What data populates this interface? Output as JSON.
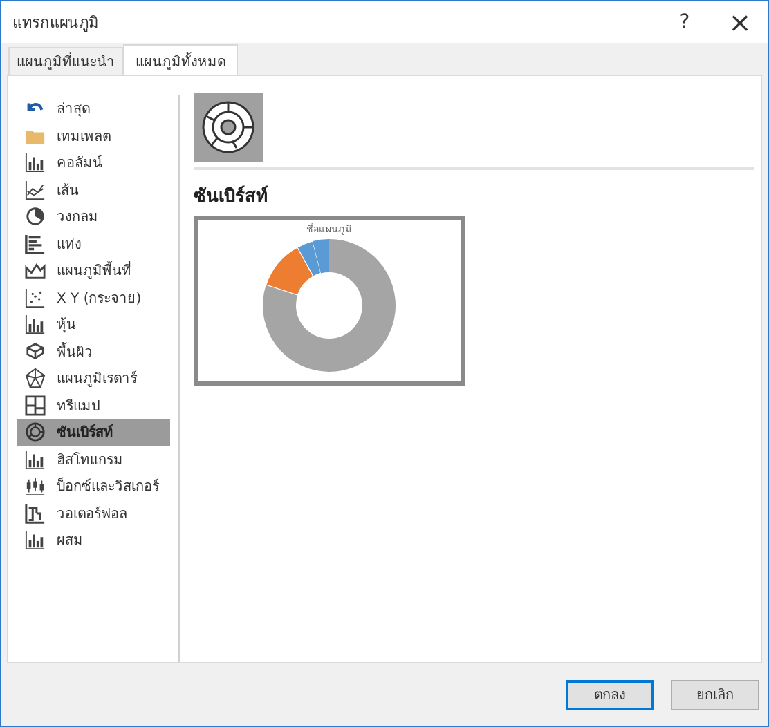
{
  "window": {
    "title": "แทรกแผนภูมิ",
    "help": "?",
    "close": "×"
  },
  "tabs": [
    {
      "label": "แผนภูมิที่แนะนำ",
      "selected": false
    },
    {
      "label": "แผนภูมิทั้งหมด",
      "selected": true
    }
  ],
  "sidebar": {
    "items": [
      {
        "label": "ล่าสุด",
        "selected": false
      },
      {
        "label": "เทมเพลต",
        "selected": false
      },
      {
        "label": "คอลัมน์",
        "selected": false
      },
      {
        "label": "เส้น",
        "selected": false
      },
      {
        "label": "วงกลม",
        "selected": false
      },
      {
        "label": "แท่ง",
        "selected": false
      },
      {
        "label": "แผนภูมิพื้นที่",
        "selected": false
      },
      {
        "label": "X Y (กระจาย)",
        "selected": false
      },
      {
        "label": "หุ้น",
        "selected": false
      },
      {
        "label": "พื้นผิว",
        "selected": false
      },
      {
        "label": "แผนภูมิเรดาร์",
        "selected": false
      },
      {
        "label": "ทรีแมป",
        "selected": false
      },
      {
        "label": "ซันเบิร์สท์",
        "selected": true
      },
      {
        "label": "ฮิสโทแกรม",
        "selected": false
      },
      {
        "label": "บ็อกซ์และวิสเกอร์",
        "selected": false
      },
      {
        "label": "วอเตอร์ฟอล",
        "selected": false
      },
      {
        "label": "ผสม",
        "selected": false
      }
    ]
  },
  "preview": {
    "heading": "ซันเบิร์สท์",
    "chart_title": "ชื่อแผนภูมิ"
  },
  "buttons": [
    {
      "label": "ตกลง",
      "kind": "primary"
    },
    {
      "label": "ยกเลิก",
      "kind": "secondary"
    }
  ]
}
